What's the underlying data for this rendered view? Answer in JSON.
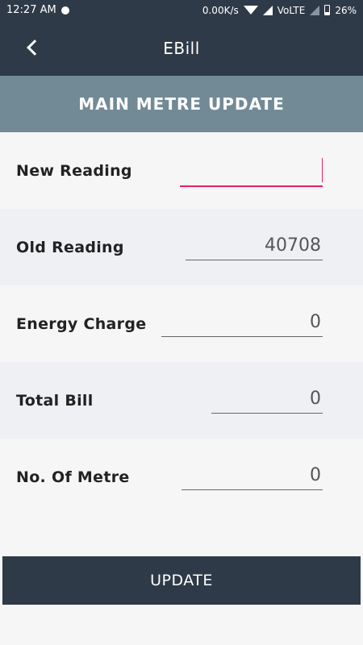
{
  "status_bar": {
    "time": "12:27 AM",
    "speed": "0.00K/s",
    "network": "VoLTE",
    "battery": "26%"
  },
  "app_bar": {
    "title": "EBill"
  },
  "section": {
    "title": "MAIN METRE UPDATE"
  },
  "form": {
    "new_reading_label": "New Reading",
    "new_reading_value": "",
    "old_reading_label": "Old Reading",
    "old_reading_value": "40708",
    "energy_charge_label": "Energy Charge",
    "energy_charge_value": "0",
    "total_bill_label": "Total Bill",
    "total_bill_value": "0",
    "no_of_metre_label": "No. Of Metre",
    "no_of_metre_value": "0"
  },
  "actions": {
    "update_label": "UPDATE"
  }
}
